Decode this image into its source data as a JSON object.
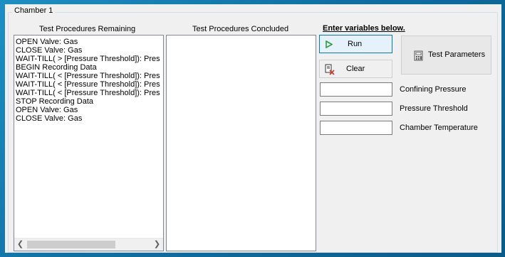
{
  "group": {
    "title": "Chamber 1"
  },
  "remaining": {
    "header": "Test Procedures Remaining",
    "items": [
      "OPEN Valve: Gas",
      "CLOSE Valve: Gas",
      "WAIT-TILL( > [Pressure Threshold]): Pres",
      "BEGIN Recording Data",
      "WAIT-TILL( < [Pressure Threshold]): Pres",
      "WAIT-TILL( < [Pressure Threshold]): Pres",
      "WAIT-TILL( < [Pressure Threshold]): Pres",
      "STOP Recording Data",
      "OPEN Valve: Gas",
      "CLOSE Valve: Gas"
    ],
    "scroll_left_icon": "chevron-left-icon",
    "scroll_right_icon": "chevron-right-icon"
  },
  "concluded": {
    "header": "Test Procedures Concluded",
    "items": []
  },
  "variables": {
    "heading": "Enter variables below.",
    "fields": [
      {
        "label": "Confining Pressure",
        "value": ""
      },
      {
        "label": "Pressure Threshold",
        "value": ""
      },
      {
        "label": "Chamber Temperature",
        "value": ""
      }
    ]
  },
  "buttons": {
    "run": {
      "label": "Run",
      "icon": "play-icon",
      "color": "#2e9e3e"
    },
    "clear": {
      "label": "Clear",
      "icon": "clear-document-icon",
      "color": "#d03a2f"
    },
    "test_parameters": {
      "label": "Test Parameters",
      "icon": "calculator-icon"
    }
  }
}
